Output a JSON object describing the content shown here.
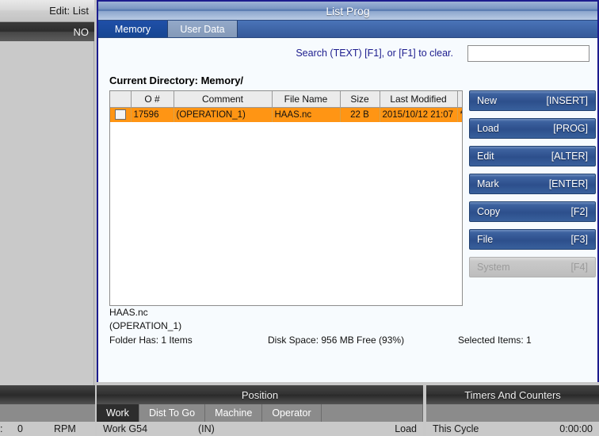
{
  "left_panel": {
    "mode_label": "Edit: List",
    "status_label": "NO",
    "spindle_value": "0",
    "spindle_unit": "RPM",
    "spindle_prefix": ":"
  },
  "window": {
    "title": "List Prog",
    "tabs": [
      {
        "label": "Memory",
        "active": true
      },
      {
        "label": "User Data",
        "active": false
      }
    ]
  },
  "search": {
    "label": "Search (TEXT) [F1], or [F1] to clear.",
    "value": "",
    "placeholder": ""
  },
  "directory": {
    "label": "Current Directory: Memory/"
  },
  "table": {
    "columns": [
      "",
      "O #",
      "Comment",
      "File Name",
      "Size",
      "Last Modified",
      ""
    ],
    "rows": [
      {
        "checked": false,
        "o_number": "17596",
        "comment": "(OPERATION_1)",
        "file_name": "HAAS.nc",
        "size": "22 B",
        "last_modified": "2015/10/12 21:07",
        "status": "*",
        "selected": true
      }
    ]
  },
  "side_buttons": [
    {
      "label": "New",
      "key": "[INSERT]",
      "disabled": false
    },
    {
      "label": "Load",
      "key": "[PROG]",
      "disabled": false
    },
    {
      "label": "Edit",
      "key": "[ALTER]",
      "disabled": false
    },
    {
      "label": "Mark",
      "key": "[ENTER]",
      "disabled": false
    },
    {
      "label": "Copy",
      "key": "[F2]",
      "disabled": false
    },
    {
      "label": "File",
      "key": "[F3]",
      "disabled": false
    },
    {
      "label": "System",
      "key": "[F4]",
      "disabled": true
    }
  ],
  "footer": {
    "file_name": "HAAS.nc",
    "file_comment": "(OPERATION_1)",
    "folder_has": "Folder Has: 1 Items",
    "disk_space": "Disk Space: 956 MB Free (93%)",
    "selected_items": "Selected Items: 1"
  },
  "position_panel": {
    "title": "Position",
    "tabs": [
      {
        "label": "Work",
        "active": true
      },
      {
        "label": "Dist To Go",
        "active": false
      },
      {
        "label": "Machine",
        "active": false
      },
      {
        "label": "Operator",
        "active": false
      }
    ],
    "row_label": "Work G54",
    "row_units": "(IN)",
    "row_right": "Load"
  },
  "timers_panel": {
    "title": "Timers And Counters",
    "row_label": "This Cycle",
    "row_value": "0:00:00"
  },
  "colors": {
    "selected_row": "#ff9514",
    "window_border": "#1c1c8e",
    "accent_blue": "#2d4f8c",
    "label_blue": "#1c1c8e"
  }
}
